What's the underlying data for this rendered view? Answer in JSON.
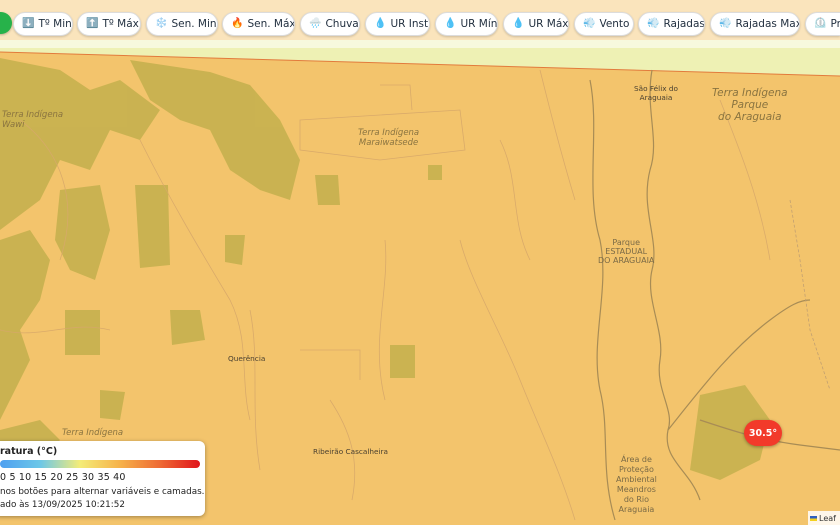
{
  "toolbar": {
    "buttons": [
      {
        "icon": "⬇️",
        "label": "Tº Min",
        "icon_name": "arrow-down-icon"
      },
      {
        "icon": "⬆️",
        "label": "Tº Máx",
        "icon_name": "arrow-up-icon"
      },
      {
        "icon": "❄️",
        "label": "Sen. Min",
        "icon_name": "snowflake-icon"
      },
      {
        "icon": "🔥",
        "label": "Sen. Máx",
        "icon_name": "fire-icon"
      },
      {
        "icon": "🌧️",
        "label": "Chuva",
        "icon_name": "rain-cloud-icon"
      },
      {
        "icon": "💧",
        "label": "UR Inst",
        "icon_name": "droplet-icon"
      },
      {
        "icon": "💧",
        "label": "UR Mín",
        "icon_name": "droplet-icon"
      },
      {
        "icon": "💧",
        "label": "UR Máx",
        "icon_name": "droplet-icon"
      },
      {
        "icon": "💨",
        "label": "Vento",
        "icon_name": "wind-icon"
      },
      {
        "icon": "💨",
        "label": "Rajadas",
        "icon_name": "wind-icon"
      },
      {
        "icon": "💨",
        "label": "Rajadas Max",
        "icon_name": "wind-icon"
      },
      {
        "icon": "⏲️",
        "label": "Pre",
        "icon_name": "gauge-icon"
      }
    ]
  },
  "map_labels": {
    "ti_wawi": "Terra Indígena\nWawi",
    "ti_maraiwatsede": "Terra Indígena\nMaraiwatsede",
    "ti_parque_araguaia": "Terra Indígena\nParque\ndo Araguaia",
    "parque_estadual": "Parque\nESTADUAL\nDO ARAGUAIA",
    "ti_bottom_left": "Terra Indígena",
    "apa_meandros": "Área de\nProteção\nAmbiental\nMeandros\ndo Rio\nAraguaia",
    "sao_felix": "São Félix do\nAraguaia",
    "querencia": "Querência",
    "ribeirao": "Ribeirão Cascalheira"
  },
  "marker": {
    "value": "30.5°",
    "color": "#f23a2a"
  },
  "legend": {
    "title": "ratura (°C)",
    "ticks": "0 5 10 15 20 25 30 35 40",
    "hint": "nos botões para alternar variáveis e camadas.",
    "updated": "ado às 13/09/2025 10:21:52"
  },
  "attribution": "Leaf",
  "colors": {
    "base": "#f3c46c",
    "forest": "#c9b04c",
    "top_strip": "#eef3b0",
    "marker": "#f23a2a"
  }
}
